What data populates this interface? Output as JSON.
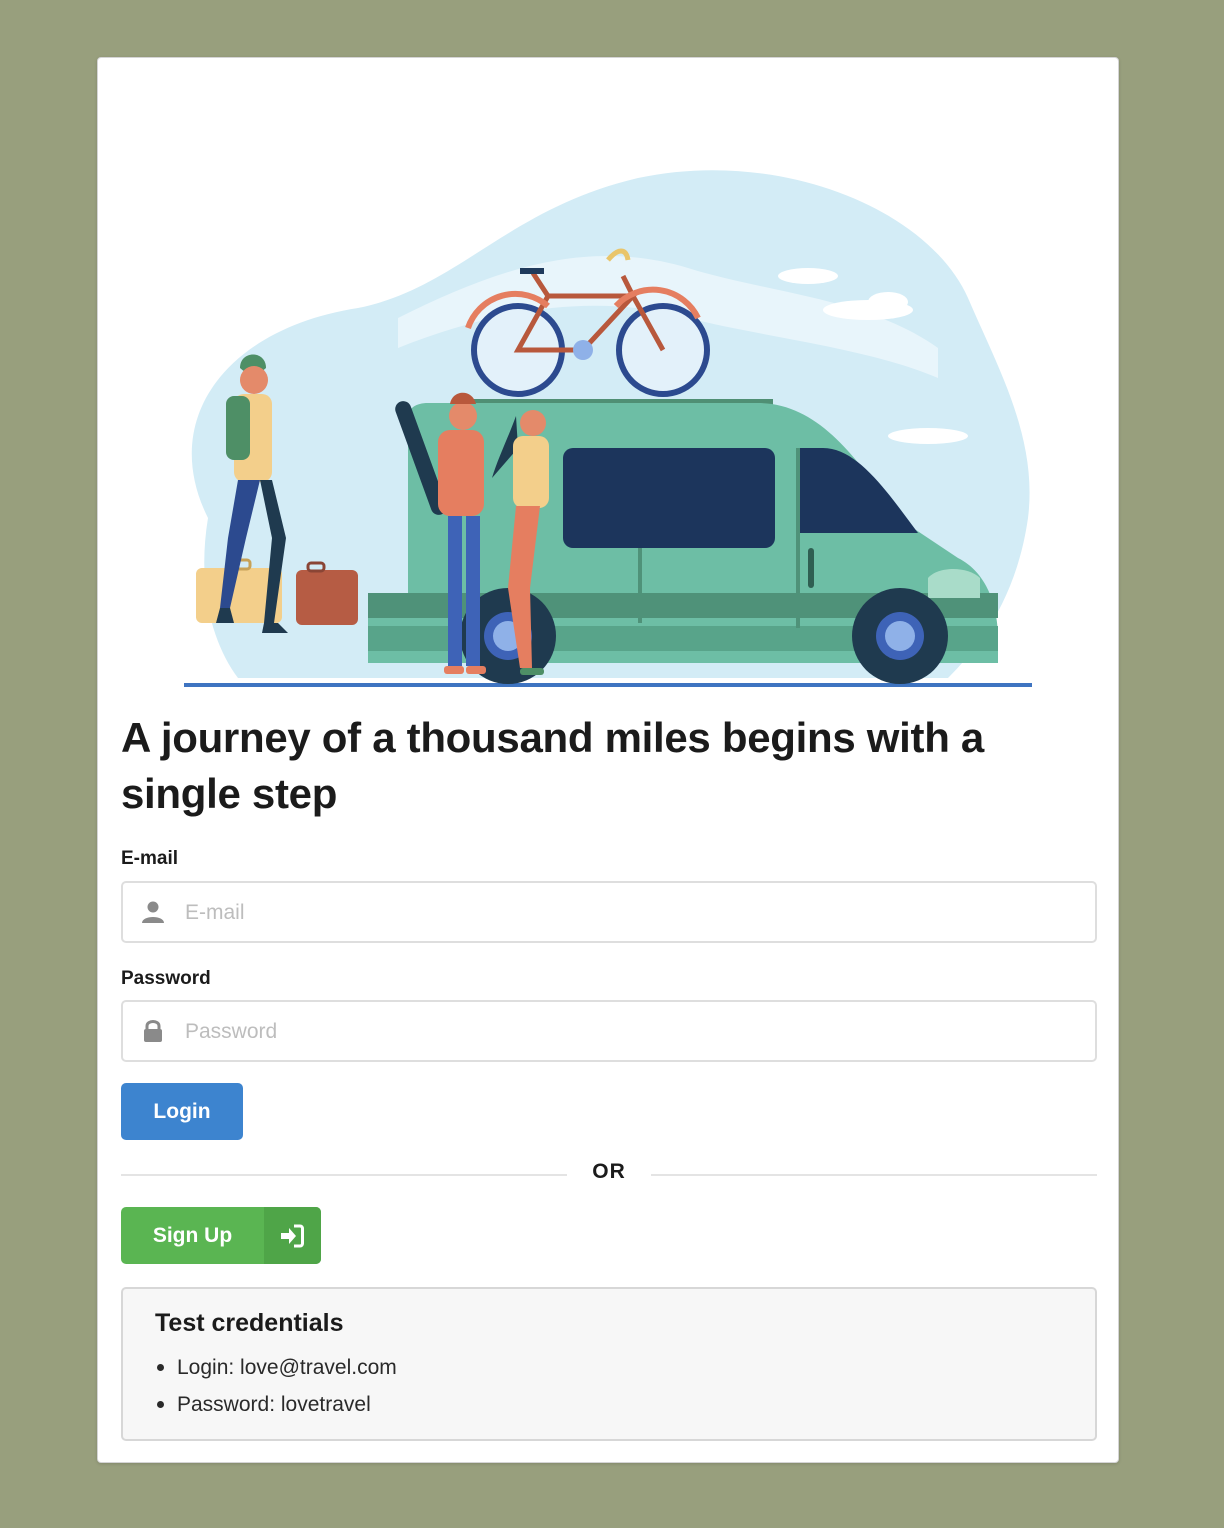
{
  "hero": {
    "alt": "Travelers loading a green van with a bicycle on the roof rack"
  },
  "heading": "A journey of a thousand miles begins with a single step",
  "email": {
    "label": "E-mail",
    "placeholder": "E-mail",
    "value": "",
    "icon": "user-icon"
  },
  "password": {
    "label": "Password",
    "placeholder": "Password",
    "value": "",
    "icon": "lock-icon"
  },
  "login_button": {
    "label": "Login"
  },
  "divider_text": "OR",
  "signup_button": {
    "label": "Sign Up",
    "icon": "sign-in-icon"
  },
  "test_credentials": {
    "title": "Test credentials",
    "items": [
      {
        "text": "Login: love@travel.com"
      },
      {
        "text": "Password: lovetravel"
      }
    ]
  },
  "colors": {
    "page_background": "#989f7d",
    "primary": "#3d84cf",
    "success": "#5ab552",
    "van": "#6dbea5"
  }
}
